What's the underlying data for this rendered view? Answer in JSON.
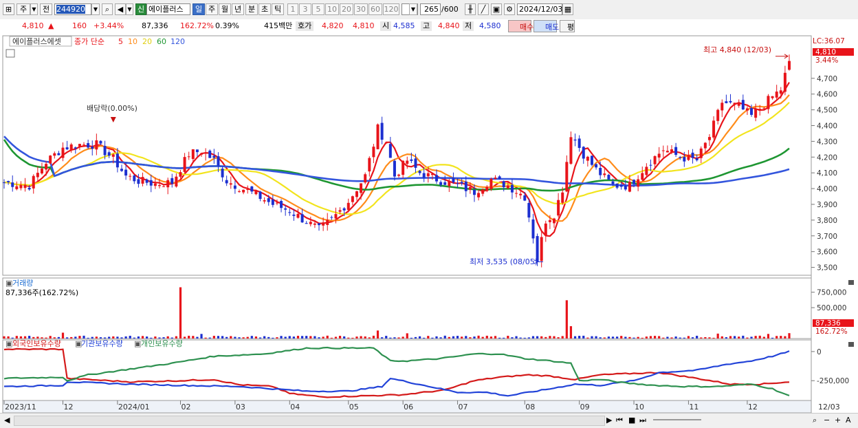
{
  "toolbar": {
    "period_select": "주",
    "prev_button": "전",
    "code": "244920",
    "name": "에이플러스",
    "sin_label": "신",
    "period_tabs": [
      "일",
      "주",
      "월",
      "년",
      "분",
      "초",
      "틱"
    ],
    "active_tab": "일",
    "num_tabs": [
      "1",
      "3",
      "5",
      "10",
      "20",
      "30",
      "60",
      "120"
    ],
    "count": "265",
    "count_total": "/600",
    "date": "2024/12/03"
  },
  "quote": {
    "price": "4,810",
    "change": "160",
    "change_pct": "+3.44%",
    "volume": "87,336",
    "volume_ratio": "162.72%",
    "turnover_pct": "0.39%",
    "amount": "415백만",
    "hoga_label": "호가",
    "ask": "4,820",
    "bid": "4,810",
    "open_label": "시",
    "open": "4,585",
    "high_label": "고",
    "high": "4,840",
    "low_label": "저",
    "low": "4,580",
    "buy_label": "매수",
    "sell_label": "매도",
    "eval_label": "평"
  },
  "colors": {
    "up": "#e8141a",
    "down": "#1c2fd0",
    "ma5": "#e8141a",
    "ma10": "#ff8c1a",
    "ma20": "#f2e41d",
    "ma60": "#1e9632",
    "ma120": "#3355dd",
    "foreign": "#d41a1a",
    "inst": "#2243d8",
    "indiv": "#2e9150"
  },
  "chart_data": [
    {
      "type": "candlestick",
      "title": "에이플러스에셋",
      "legend": [
        "종가 단순",
        "5",
        "10",
        "20",
        "60",
        "120"
      ],
      "y_ticks": [
        4700,
        4600,
        4500,
        4400,
        4300,
        4200,
        4100,
        4000,
        3900,
        3800,
        3700,
        3600,
        3500
      ],
      "y_tick_labels": [
        "4,700",
        "4,600",
        "4,500",
        "4,400",
        "4,300",
        "4,200",
        "4,100",
        "4,000",
        "3,900",
        "3,800",
        "3,700",
        "3,600",
        "3,500"
      ],
      "ylim": [
        3450,
        4970
      ],
      "badges": {
        "lc": "LC:36.07",
        "price": "4,810",
        "pct": "3.44%"
      },
      "annotations": {
        "dividend": "배당락(0.00%)",
        "high": "최고 4,840 (12/03)",
        "low": "최저 3,535 (08/05)"
      },
      "price_path": [
        [
          0,
          4040
        ],
        [
          6,
          4020
        ],
        [
          10,
          4170
        ],
        [
          14,
          4260
        ],
        [
          18,
          4280
        ],
        [
          22,
          4280
        ],
        [
          26,
          4190
        ],
        [
          29,
          4080
        ],
        [
          32,
          4050
        ],
        [
          36,
          4030
        ],
        [
          40,
          4040
        ],
        [
          44,
          4220
        ],
        [
          47,
          4240
        ],
        [
          50,
          4180
        ],
        [
          53,
          4050
        ],
        [
          56,
          4010
        ],
        [
          60,
          3960
        ],
        [
          64,
          3900
        ],
        [
          68,
          3860
        ],
        [
          72,
          3790
        ],
        [
          75,
          3740
        ],
        [
          78,
          3800
        ],
        [
          82,
          3920
        ],
        [
          86,
          4080
        ],
        [
          89,
          4380
        ],
        [
          91,
          4300
        ],
        [
          93,
          4080
        ],
        [
          96,
          4180
        ],
        [
          99,
          4100
        ],
        [
          103,
          4060
        ],
        [
          108,
          4020
        ],
        [
          112,
          3980
        ],
        [
          116,
          4060
        ],
        [
          120,
          4020
        ],
        [
          124,
          3950
        ],
        [
          126,
          3700
        ],
        [
          127,
          3550
        ],
        [
          129,
          3800
        ],
        [
          131,
          3840
        ],
        [
          133,
          4000
        ],
        [
          135,
          4350
        ],
        [
          138,
          4220
        ],
        [
          141,
          4120
        ],
        [
          145,
          4020
        ],
        [
          149,
          4020
        ],
        [
          153,
          4150
        ],
        [
          157,
          4250
        ],
        [
          161,
          4200
        ],
        [
          165,
          4180
        ],
        [
          168,
          4330
        ],
        [
          171,
          4550
        ],
        [
          175,
          4520
        ],
        [
          178,
          4460
        ],
        [
          182,
          4560
        ],
        [
          185,
          4630
        ],
        [
          187,
          4810
        ]
      ],
      "ma_lengths": [
        5,
        10,
        20,
        60,
        120
      ]
    },
    {
      "type": "bar",
      "title": "거래량",
      "value_label": "87,336주(162.72%)",
      "y_ticks": [
        750000,
        500000
      ],
      "y_tick_labels": [
        "750,000",
        "500,000"
      ],
      "ylim": [
        0,
        980000
      ],
      "badges": {
        "vol": "87,336",
        "pct": "162.72%"
      },
      "spikes": [
        [
          14,
          95000
        ],
        [
          42,
          830000
        ],
        [
          47,
          75000
        ],
        [
          89,
          130000
        ],
        [
          96,
          85000
        ],
        [
          134,
          620000
        ],
        [
          135,
          200000
        ],
        [
          170,
          80000
        ],
        [
          182,
          75000
        ]
      ],
      "last_value": 87336
    },
    {
      "type": "line",
      "legend": [
        "외국인보유수량",
        "기관보유수량",
        "개인보유수량"
      ],
      "y_ticks": [
        0,
        -250000
      ],
      "y_tick_labels": [
        "0",
        "-250,000"
      ],
      "ylim": [
        -420000,
        100000
      ],
      "series": [
        {
          "name": "외국인보유수량",
          "points": [
            [
              0,
              20000
            ],
            [
              14,
              20000
            ],
            [
              15,
              -230000
            ],
            [
              30,
              -260000
            ],
            [
              42,
              -250000
            ],
            [
              50,
              -240000
            ],
            [
              56,
              -285000
            ],
            [
              64,
              -300000
            ],
            [
              68,
              -360000
            ],
            [
              76,
              -390000
            ],
            [
              86,
              -380000
            ],
            [
              95,
              -370000
            ],
            [
              105,
              -330000
            ],
            [
              112,
              -250000
            ],
            [
              118,
              -220000
            ],
            [
              125,
              -200000
            ],
            [
              130,
              -210000
            ],
            [
              136,
              -240000
            ],
            [
              142,
              -200000
            ],
            [
              148,
              -190000
            ],
            [
              156,
              -180000
            ],
            [
              165,
              -230000
            ],
            [
              173,
              -280000
            ],
            [
              180,
              -280000
            ],
            [
              187,
              -260000
            ]
          ]
        },
        {
          "name": "기관보유수량",
          "points": [
            [
              0,
              -300000
            ],
            [
              14,
              -290000
            ],
            [
              15,
              -260000
            ],
            [
              30,
              -280000
            ],
            [
              42,
              -290000
            ],
            [
              56,
              -300000
            ],
            [
              64,
              -320000
            ],
            [
              72,
              -340000
            ],
            [
              82,
              -340000
            ],
            [
              90,
              -300000
            ],
            [
              92,
              -230000
            ],
            [
              96,
              -260000
            ],
            [
              104,
              -320000
            ],
            [
              108,
              -350000
            ],
            [
              115,
              -350000
            ],
            [
              120,
              -380000
            ],
            [
              125,
              -350000
            ],
            [
              130,
              -320000
            ],
            [
              136,
              -280000
            ],
            [
              142,
              -290000
            ],
            [
              150,
              -250000
            ],
            [
              156,
              -180000
            ],
            [
              165,
              -160000
            ],
            [
              172,
              -110000
            ],
            [
              178,
              -80000
            ],
            [
              183,
              -40000
            ],
            [
              187,
              0
            ]
          ]
        },
        {
          "name": "개인보유수량",
          "points": [
            [
              0,
              -230000
            ],
            [
              14,
              -220000
            ],
            [
              15,
              -250000
            ],
            [
              20,
              -200000
            ],
            [
              30,
              -150000
            ],
            [
              40,
              -100000
            ],
            [
              50,
              -40000
            ],
            [
              62,
              -20000
            ],
            [
              72,
              30000
            ],
            [
              82,
              30000
            ],
            [
              88,
              30000
            ],
            [
              92,
              -80000
            ],
            [
              96,
              -80000
            ],
            [
              104,
              -60000
            ],
            [
              112,
              -20000
            ],
            [
              118,
              -20000
            ],
            [
              124,
              -60000
            ],
            [
              130,
              -80000
            ],
            [
              135,
              -100000
            ],
            [
              137,
              -250000
            ],
            [
              142,
              -240000
            ],
            [
              148,
              -270000
            ],
            [
              155,
              -290000
            ],
            [
              162,
              -300000
            ],
            [
              170,
              -300000
            ],
            [
              178,
              -280000
            ],
            [
              183,
              -320000
            ],
            [
              187,
              -380000
            ]
          ]
        }
      ]
    },
    {
      "type": "axis",
      "x_labels": [
        {
          "pos": 0,
          "label": "2023/11"
        },
        {
          "pos": 14,
          "label": "12"
        },
        {
          "pos": 27,
          "label": "2024/01"
        },
        {
          "pos": 42,
          "label": "02"
        },
        {
          "pos": 55,
          "label": "03"
        },
        {
          "pos": 68,
          "label": "04"
        },
        {
          "pos": 82,
          "label": "05"
        },
        {
          "pos": 95,
          "label": "06"
        },
        {
          "pos": 108,
          "label": "07"
        },
        {
          "pos": 124,
          "label": "08"
        },
        {
          "pos": 137,
          "label": "09"
        },
        {
          "pos": 150,
          "label": "10"
        },
        {
          "pos": 163,
          "label": "11"
        },
        {
          "pos": 177,
          "label": "12"
        }
      ],
      "current_label": "12/03"
    }
  ]
}
